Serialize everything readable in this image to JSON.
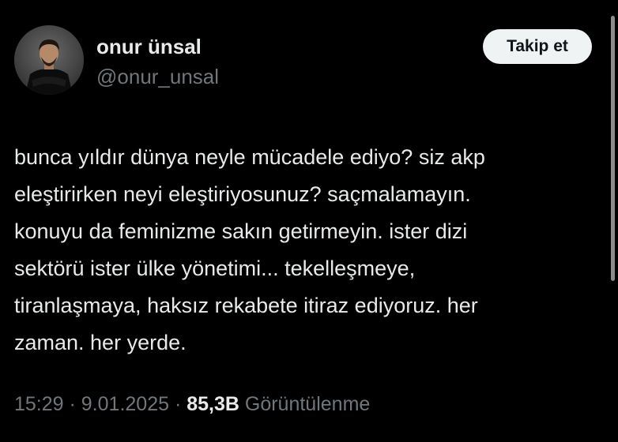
{
  "author": {
    "display_name": "onur ünsal",
    "handle": "@onur_unsal"
  },
  "follow_button": {
    "label": "Takip et"
  },
  "tweet": {
    "lines": [
      "bunca yıldır dünya neyle mücadele ediyo? siz akp",
      "eleştirirken neyi eleştiriyosunuz? saçmalamayın.",
      "konuyu da feminizme sakın getirmeyin. ister dizi",
      "sektörü ister ülke yönetimi... tekelleşmeye,",
      "tiranlaşmaya, haksız rekabete itiraz ediyoruz. her",
      "zaman. her yerde."
    ]
  },
  "meta": {
    "time": "15:29",
    "sep1": " · ",
    "date": "9.01.2025",
    "sep2": " · ",
    "views_count": "85,3B",
    "views_label": " Görüntülenme"
  },
  "colors": {
    "background": "#000000",
    "text_primary": "#e7e9ea",
    "text_secondary": "#71767b",
    "button_bg": "#eff3f4",
    "button_text": "#0f1419"
  },
  "icons": {
    "avatar": "avatar-photo"
  }
}
